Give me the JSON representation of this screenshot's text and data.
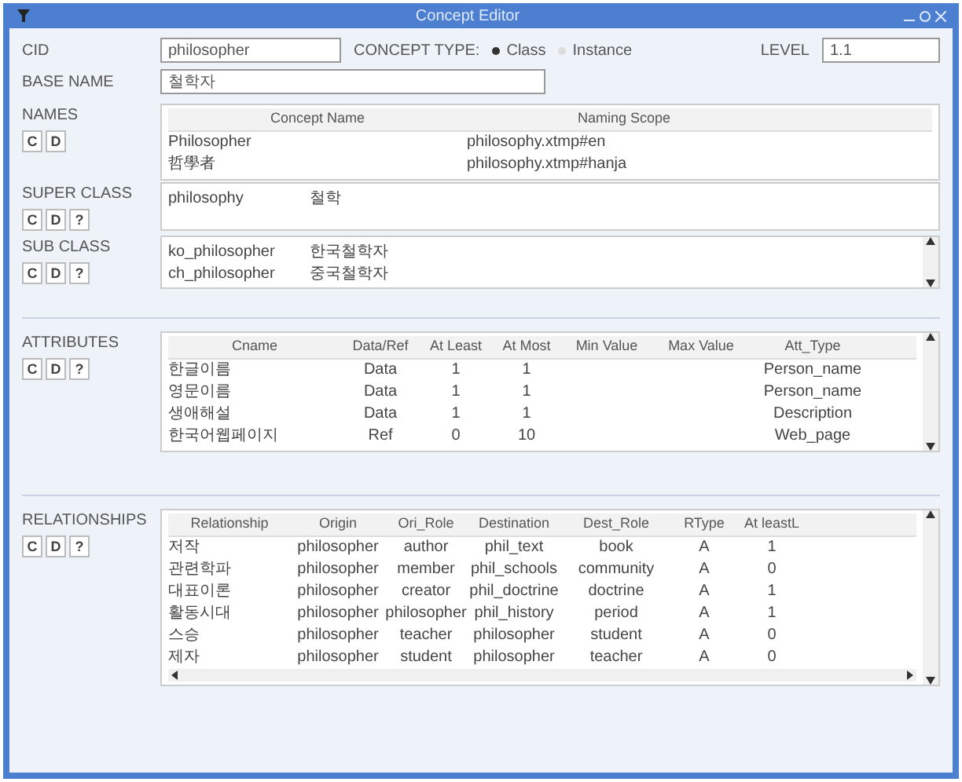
{
  "window": {
    "title": "Concept Editor"
  },
  "cid": {
    "label": "CID",
    "value": "philosopher"
  },
  "concept_type": {
    "label": "CONCEPT TYPE:",
    "options": [
      {
        "label": "Class",
        "selected": true
      },
      {
        "label": "Instance",
        "selected": false
      }
    ]
  },
  "level": {
    "label": "LEVEL",
    "value": "1.1"
  },
  "base_name": {
    "label": "BASE NAME",
    "value": "철학자"
  },
  "sections": [
    {
      "kind": "table",
      "label": "NAMES",
      "buttons": [
        "C",
        "D"
      ],
      "columns": [
        "Concept Name",
        "Naming Scope"
      ],
      "rows": [
        [
          "Philosopher",
          "philosophy.xtmp#en"
        ],
        [
          "哲學者",
          "philosophy.xtmp#hanja"
        ]
      ]
    },
    {
      "kind": "list",
      "label": "SUPER CLASS",
      "buttons": [
        "C",
        "D",
        "?"
      ],
      "rows": [
        [
          "philosophy",
          "철학"
        ]
      ]
    },
    {
      "kind": "list",
      "label": "SUB CLASS",
      "buttons": [
        "C",
        "D",
        "?"
      ],
      "scroll": true,
      "rows": [
        [
          "ko_philosopher",
          "한국철학자"
        ],
        [
          "ch_philosopher",
          "중국철학자"
        ]
      ]
    },
    {
      "kind": "table",
      "label": "ATTRIBUTES",
      "buttons": [
        "C",
        "D",
        "?"
      ],
      "scroll": true,
      "columns": [
        "Cname",
        "Data/Ref",
        "At Least",
        "At Most",
        "Min Value",
        "Max Value",
        "Att_Type"
      ],
      "rows": [
        [
          "한글이름",
          "Data",
          "1",
          "1",
          "",
          "",
          "Person_name"
        ],
        [
          "영문이름",
          "Data",
          "1",
          "1",
          "",
          "",
          "Person_name"
        ],
        [
          "생애해설",
          "Data",
          "1",
          "1",
          "",
          "",
          "Description"
        ],
        [
          "한국어웹페이지",
          "Ref",
          "0",
          "10",
          "",
          "",
          "Web_page"
        ]
      ]
    },
    {
      "kind": "table",
      "label": "RELATIONSHIPS",
      "buttons": [
        "C",
        "D",
        "?"
      ],
      "scroll": true,
      "hscroll": true,
      "columns": [
        "Relationship",
        "Origin",
        "Ori_Role",
        "Destination",
        "Dest_Role",
        "RType",
        "At leastL"
      ],
      "rows": [
        [
          "저작",
          "philosopher",
          "author",
          "phil_text",
          "book",
          "A",
          "1"
        ],
        [
          "관련학파",
          "philosopher",
          "member",
          "phil_schools",
          "community",
          "A",
          "0"
        ],
        [
          "대표이론",
          "philosopher",
          "creator",
          "phil_doctrine",
          "doctrine",
          "A",
          "1"
        ],
        [
          "활동시대",
          "philosopher",
          "philosopher",
          "phil_history",
          "period",
          "A",
          "1"
        ],
        [
          "스승",
          "philosopher",
          "teacher",
          "philosopher",
          "student",
          "A",
          "0"
        ],
        [
          "제자",
          "philosopher",
          "student",
          "philosopher",
          "teacher",
          "A",
          "0"
        ]
      ]
    }
  ]
}
